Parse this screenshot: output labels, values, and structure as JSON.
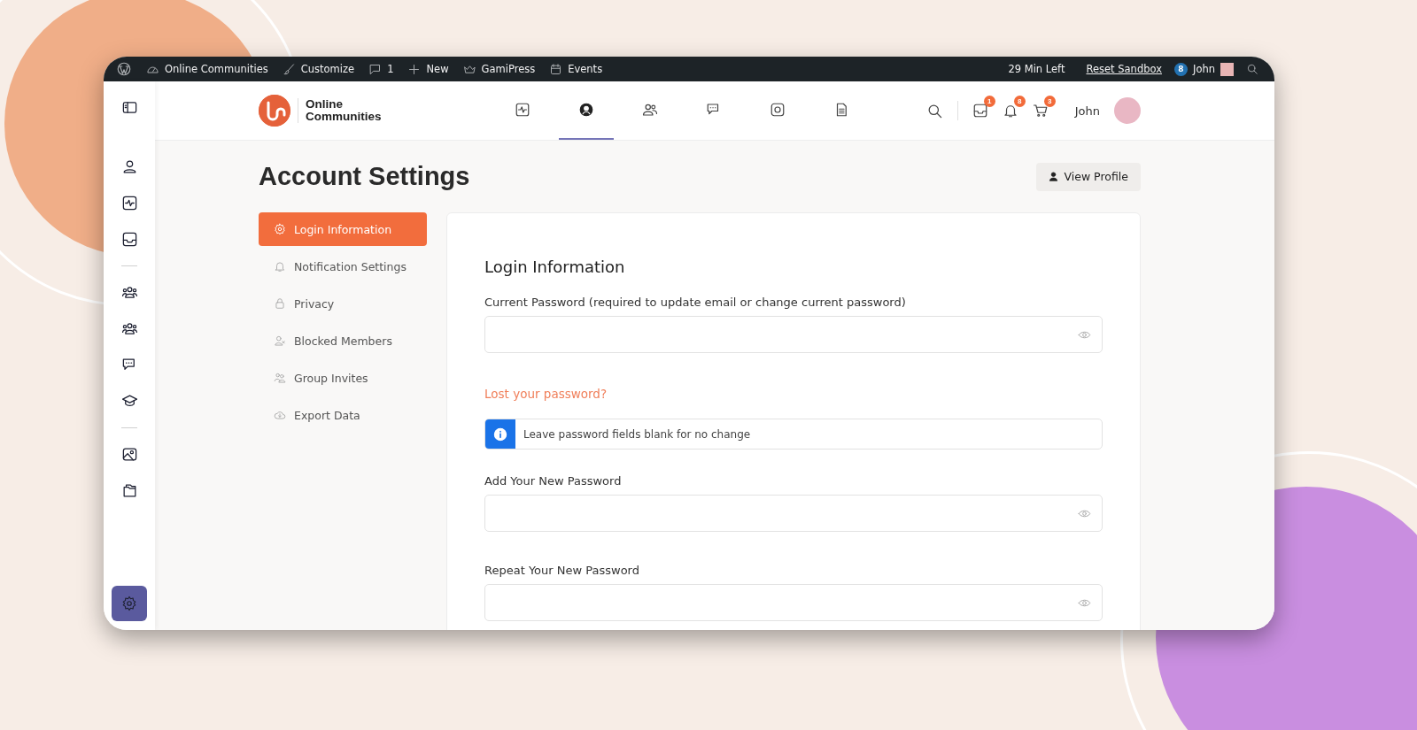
{
  "admin_bar": {
    "items": [
      {
        "kind": "wordpress"
      },
      {
        "kind": "dashboard",
        "label": "Online Communities"
      },
      {
        "kind": "brush",
        "label": "Customize"
      },
      {
        "kind": "comment",
        "label": "1"
      },
      {
        "kind": "plus",
        "label": "New"
      },
      {
        "kind": "crown",
        "label": "GamiPress"
      },
      {
        "kind": "calendar",
        "label": "Events"
      }
    ],
    "timer": "29 Min Left",
    "reset": "Reset Sandbox",
    "badge": "8",
    "user": "John"
  },
  "rail": {
    "groups": [
      [
        {
          "kind": "user"
        },
        {
          "kind": "activity"
        },
        {
          "kind": "inbox"
        }
      ],
      [
        {
          "kind": "groups"
        },
        {
          "kind": "groups"
        },
        {
          "kind": "chat"
        },
        {
          "kind": "course"
        }
      ],
      [
        {
          "kind": "photo"
        },
        {
          "kind": "folder"
        }
      ]
    ]
  },
  "header": {
    "logo_line_1": "Online",
    "logo_line_2": "Communities",
    "nav": [
      {
        "kind": "activity",
        "selected": false
      },
      {
        "kind": "profile",
        "selected": true
      },
      {
        "kind": "members",
        "selected": false
      },
      {
        "kind": "chat",
        "selected": false
      },
      {
        "kind": "media",
        "selected": false
      },
      {
        "kind": "document",
        "selected": false
      }
    ],
    "actions": [
      {
        "kind": "inbox",
        "count": "1"
      },
      {
        "kind": "bell",
        "count": "8"
      },
      {
        "kind": "cart",
        "count": "3"
      }
    ],
    "user": "John"
  },
  "page": {
    "title": "Account Settings",
    "view_profile": "View Profile",
    "menu": [
      {
        "kind": "gear",
        "label": "Login Information",
        "selected": true
      },
      {
        "kind": "bell",
        "label": "Notification Settings",
        "selected": false
      },
      {
        "kind": "lock",
        "label": "Privacy",
        "selected": false
      },
      {
        "kind": "blocked",
        "label": "Blocked Members",
        "selected": false
      },
      {
        "kind": "invite",
        "label": "Group Invites",
        "selected": false
      },
      {
        "kind": "cloud",
        "label": "Export Data",
        "selected": false
      }
    ],
    "form": {
      "heading": "Login Information",
      "rows": [
        {
          "kind": "field",
          "label": "Current Password (required to update email or change current password)"
        },
        {
          "kind": "link",
          "label": "Lost your password?"
        },
        {
          "kind": "notice",
          "label": "Leave password fields blank for no change"
        },
        {
          "kind": "field",
          "label": "Add Your New Password"
        },
        {
          "kind": "field",
          "label": "Repeat Your New Password"
        }
      ]
    }
  }
}
